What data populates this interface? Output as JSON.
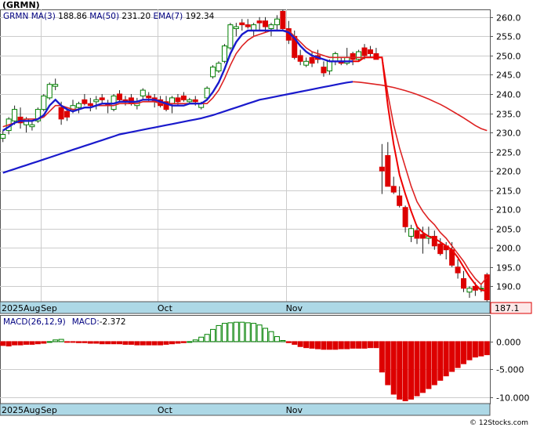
{
  "title": "(GRMN)",
  "footer": "© 12Stocks.com",
  "legend": {
    "symbol": "GRMN",
    "ma3_label": "MA(3)",
    "ma3_value": "188.86",
    "ma50_label": "MA(50)",
    "ma50_value": "231.20",
    "ema7_label": "EMA(7)",
    "ema7_value": "192.34"
  },
  "last_price_label": "187.1",
  "macd_legend": {
    "label": "MACD(26,12,9)",
    "value_label": "MACD:",
    "value": "-2.372"
  },
  "colors": {
    "up": "#008000",
    "down": "#dd0000",
    "ma_fast": "#1a1acc",
    "ma_slow_up": "#1a1acc",
    "ma_slow_down": "#dd2222",
    "axis_band": "#add8e6",
    "grid": "#cccccc"
  },
  "chart_data": [
    {
      "type": "candlestick",
      "ylim": [
        186,
        262
      ],
      "y_ticks": [
        190,
        195,
        200,
        205,
        210,
        215,
        220,
        225,
        230,
        235,
        240,
        245,
        250,
        255,
        260
      ],
      "y_tick_labels": [
        "190.0",
        "195.0",
        "200.0",
        "205.0",
        "210.0",
        "215.0",
        "220.0",
        "225.0",
        "230.0",
        "235.0",
        "240.0",
        "245.0",
        "250.0",
        "255.0",
        "260.0"
      ],
      "x_labels": [
        {
          "index": 0,
          "text": "2025Aug"
        },
        {
          "index": 7,
          "text": "Sep"
        },
        {
          "index": 27,
          "text": "Oct"
        },
        {
          "index": 49,
          "text": "Nov"
        }
      ],
      "grid": true,
      "ohlc": [
        [
          228.5,
          230.5,
          227.5,
          229.5
        ],
        [
          230.5,
          234.0,
          229.5,
          233.5
        ],
        [
          233.0,
          237.0,
          232.0,
          236.0
        ],
        [
          234.0,
          236.5,
          231.0,
          232.5
        ],
        [
          232.0,
          234.0,
          230.0,
          233.5
        ],
        [
          231.5,
          233.0,
          230.5,
          232.0
        ],
        [
          233.0,
          236.5,
          232.5,
          236.0
        ],
        [
          236.0,
          240.0,
          235.5,
          239.5
        ],
        [
          239.0,
          243.0,
          238.5,
          242.5
        ],
        [
          242.0,
          244.0,
          241.0,
          242.5
        ],
        [
          236.5,
          238.0,
          232.0,
          233.5
        ],
        [
          235.5,
          236.5,
          233.0,
          234.0
        ],
        [
          236.0,
          238.5,
          235.0,
          237.0
        ],
        [
          236.5,
          238.0,
          235.0,
          237.5
        ],
        [
          238.5,
          240.0,
          237.0,
          237.5
        ],
        [
          237.5,
          239.0,
          235.5,
          237.0
        ],
        [
          238.0,
          239.5,
          236.0,
          238.5
        ],
        [
          239.0,
          240.0,
          237.5,
          238.5
        ],
        [
          237.5,
          238.5,
          235.0,
          237.0
        ],
        [
          236.0,
          240.0,
          235.5,
          239.5
        ],
        [
          240.0,
          241.0,
          238.0,
          238.5
        ],
        [
          238.5,
          239.5,
          237.0,
          238.0
        ],
        [
          239.0,
          240.0,
          237.0,
          237.5
        ],
        [
          237.0,
          239.0,
          236.0,
          238.0
        ],
        [
          239.5,
          241.5,
          238.5,
          241.0
        ],
        [
          239.5,
          240.5,
          238.0,
          239.0
        ],
        [
          239.0,
          240.0,
          236.5,
          238.0
        ],
        [
          238.5,
          239.5,
          236.5,
          237.0
        ],
        [
          238.0,
          239.5,
          235.5,
          236.0
        ],
        [
          237.5,
          239.5,
          235.0,
          239.0
        ],
        [
          239.0,
          240.0,
          237.0,
          238.0
        ],
        [
          239.5,
          240.5,
          238.0,
          238.5
        ],
        [
          238.0,
          239.0,
          237.5,
          238.5
        ],
        [
          238.5,
          239.5,
          237.0,
          238.0
        ],
        [
          236.5,
          238.0,
          236.0,
          237.5
        ],
        [
          239.0,
          242.0,
          238.5,
          241.5
        ],
        [
          244.5,
          247.5,
          244.0,
          247.0
        ],
        [
          246.0,
          248.5,
          245.5,
          248.0
        ],
        [
          248.5,
          253.0,
          248.0,
          252.5
        ],
        [
          252.0,
          258.5,
          251.5,
          258.0
        ],
        [
          257.0,
          258.5,
          255.0,
          257.5
        ],
        [
          258.5,
          259.5,
          256.5,
          258.0
        ],
        [
          258.0,
          259.5,
          257.0,
          257.5
        ],
        [
          256.5,
          258.5,
          255.0,
          258.0
        ],
        [
          259.0,
          260.0,
          256.5,
          258.5
        ],
        [
          259.0,
          260.0,
          256.0,
          257.5
        ],
        [
          257.0,
          258.5,
          255.0,
          258.0
        ],
        [
          258.0,
          260.5,
          256.5,
          259.5
        ],
        [
          261.5,
          262.0,
          256.5,
          257.0
        ],
        [
          257.0,
          259.0,
          253.0,
          254.0
        ],
        [
          255.0,
          256.5,
          249.0,
          249.5
        ],
        [
          250.0,
          251.5,
          247.5,
          248.5
        ],
        [
          247.5,
          249.5,
          247.0,
          248.5
        ],
        [
          249.5,
          251.0,
          247.0,
          248.0
        ],
        [
          250.0,
          251.5,
          248.0,
          249.0
        ],
        [
          247.0,
          248.5,
          244.5,
          245.5
        ],
        [
          246.0,
          249.0,
          245.0,
          248.5
        ],
        [
          248.5,
          251.0,
          247.5,
          250.5
        ],
        [
          248.5,
          249.5,
          247.5,
          248.0
        ],
        [
          248.0,
          252.0,
          247.5,
          249.5
        ],
        [
          250.5,
          251.0,
          247.5,
          249.0
        ],
        [
          249.0,
          251.5,
          248.5,
          251.0
        ],
        [
          252.0,
          253.0,
          249.0,
          250.0
        ],
        [
          251.5,
          252.5,
          249.5,
          250.5
        ],
        [
          250.5,
          252.0,
          249.5,
          249.0
        ],
        [
          221.0,
          227.0,
          214.0,
          220.0
        ],
        [
          224.0,
          227.5,
          216.0,
          216.0
        ],
        [
          216.0,
          218.5,
          214.0,
          214.5
        ],
        [
          213.5,
          216.0,
          210.5,
          211.0
        ],
        [
          210.5,
          211.0,
          204.0,
          205.5
        ],
        [
          203.0,
          206.0,
          201.5,
          205.0
        ],
        [
          204.5,
          206.0,
          201.0,
          202.5
        ],
        [
          203.5,
          205.5,
          198.5,
          202.5
        ],
        [
          202.5,
          205.5,
          201.0,
          203.0
        ],
        [
          203.0,
          204.5,
          199.5,
          200.5
        ],
        [
          201.0,
          202.5,
          198.0,
          198.5
        ],
        [
          200.5,
          201.5,
          197.0,
          199.5
        ],
        [
          199.5,
          201.5,
          195.0,
          195.5
        ],
        [
          195.0,
          197.0,
          192.0,
          193.5
        ],
        [
          192.0,
          194.0,
          188.5,
          189.5
        ],
        [
          188.5,
          190.0,
          187.0,
          189.5
        ],
        [
          190.0,
          191.0,
          187.5,
          189.0
        ],
        [
          189.5,
          190.5,
          188.5,
          189.5
        ],
        [
          193.0,
          193.5,
          186.0,
          186.5
        ]
      ],
      "ma3": [
        230.5,
        231.5,
        232.5,
        233.0,
        233.0,
        233.0,
        233.5,
        234.5,
        237.0,
        238.5,
        237.0,
        236.0,
        235.5,
        236.0,
        236.5,
        236.5,
        237.0,
        237.5,
        237.5,
        237.5,
        238.0,
        238.0,
        238.0,
        238.0,
        238.5,
        238.5,
        238.5,
        238.0,
        237.5,
        237.0,
        237.0,
        237.0,
        237.5,
        237.5,
        237.5,
        238.5,
        240.5,
        243.0,
        246.5,
        250.5,
        253.5,
        255.5,
        256.5,
        256.5,
        256.5,
        256.5,
        256.5,
        256.5,
        256.5,
        256.0,
        254.5,
        252.5,
        251.0,
        250.0,
        249.5,
        249.0,
        248.5,
        248.5,
        248.5,
        248.5,
        248.5,
        248.5,
        249.5,
        249.5,
        249.5,
        249.5,
        237.0,
        227.0,
        219.0,
        214.0,
        209.5,
        205.5,
        204.0,
        203.0,
        202.5,
        201.5,
        200.5,
        199.5,
        197.5,
        195.0,
        192.5,
        190.5,
        189.0,
        188.86
      ],
      "ema7": [
        231.5,
        232.0,
        232.5,
        233.0,
        233.5,
        233.5,
        233.5,
        234.0,
        235.5,
        237.0,
        237.0,
        236.5,
        236.0,
        236.0,
        236.5,
        236.5,
        237.0,
        237.0,
        237.0,
        237.0,
        237.5,
        237.5,
        237.5,
        237.5,
        238.0,
        238.0,
        238.0,
        237.5,
        237.5,
        237.5,
        237.5,
        237.5,
        237.5,
        237.5,
        237.5,
        237.5,
        239.0,
        241.0,
        244.0,
        247.5,
        250.5,
        252.5,
        254.0,
        255.0,
        255.5,
        256.0,
        256.5,
        256.5,
        256.5,
        256.5,
        255.0,
        253.5,
        252.0,
        251.0,
        250.5,
        250.0,
        249.5,
        249.5,
        249.5,
        249.5,
        249.5,
        249.5,
        249.5,
        249.5,
        249.5,
        249.5,
        240.0,
        232.0,
        226.0,
        221.0,
        216.0,
        212.0,
        209.5,
        207.5,
        206.0,
        204.0,
        202.5,
        200.5,
        198.5,
        196.5,
        194.0,
        192.0,
        190.5,
        192.34
      ],
      "ma50": [
        219.5,
        220.0,
        220.5,
        221.0,
        221.5,
        222.0,
        222.5,
        223.0,
        223.5,
        224.0,
        224.5,
        225.0,
        225.5,
        226.0,
        226.5,
        227.0,
        227.5,
        228.0,
        228.5,
        229.0,
        229.5,
        229.8,
        230.1,
        230.4,
        230.7,
        231.0,
        231.3,
        231.6,
        231.9,
        232.2,
        232.5,
        232.8,
        233.1,
        233.4,
        233.7,
        234.1,
        234.5,
        235.0,
        235.5,
        236.0,
        236.5,
        237.0,
        237.5,
        238.0,
        238.5,
        238.8,
        239.1,
        239.4,
        239.7,
        240.0,
        240.3,
        240.6,
        240.9,
        241.2,
        241.5,
        241.8,
        242.1,
        242.4,
        242.7,
        243.0,
        243.2,
        243.1,
        242.9,
        242.7,
        242.5,
        242.3,
        242.0,
        241.7,
        241.3,
        240.9,
        240.4,
        239.9,
        239.3,
        238.7,
        238.0,
        237.3,
        236.5,
        235.6,
        234.7,
        233.8,
        232.8,
        231.8,
        231.0,
        230.5
      ],
      "ma50_color_switch_index": 60
    },
    {
      "type": "bar",
      "name": "MACD(26,12,9)",
      "ylim": [
        -11.2,
        4.8
      ],
      "y_ticks": [
        0,
        -5,
        -10
      ],
      "y_tick_labels": [
        "0.000",
        "-5.000",
        "-10.000"
      ],
      "x_labels": [
        {
          "index": 0,
          "text": "2025Aug"
        },
        {
          "index": 7,
          "text": "Sep"
        },
        {
          "index": 27,
          "text": "Oct"
        },
        {
          "index": 49,
          "text": "Nov"
        }
      ],
      "values": [
        -0.7,
        -0.8,
        -0.6,
        -0.6,
        -0.5,
        -0.5,
        -0.4,
        -0.3,
        0.0,
        0.3,
        0.4,
        -0.1,
        -0.1,
        -0.2,
        -0.2,
        -0.3,
        -0.3,
        -0.4,
        -0.4,
        -0.4,
        -0.4,
        -0.5,
        -0.5,
        -0.6,
        -0.6,
        -0.6,
        -0.6,
        -0.6,
        -0.5,
        -0.4,
        -0.3,
        -0.2,
        0.0,
        0.3,
        0.8,
        1.3,
        2.2,
        2.9,
        3.3,
        3.4,
        3.5,
        3.5,
        3.4,
        3.3,
        3.0,
        2.4,
        1.8,
        0.9,
        0.2,
        -0.2,
        -0.5,
        -0.9,
        -1.1,
        -1.2,
        -1.3,
        -1.4,
        -1.4,
        -1.4,
        -1.3,
        -1.3,
        -1.2,
        -1.2,
        -1.2,
        -1.1,
        -1.1,
        -5.5,
        -7.8,
        -9.5,
        -10.4,
        -10.7,
        -10.4,
        -9.8,
        -9.2,
        -8.5,
        -7.8,
        -7.0,
        -6.2,
        -5.4,
        -4.7,
        -4.0,
        -3.3,
        -2.8,
        -2.6,
        -2.372
      ]
    }
  ]
}
